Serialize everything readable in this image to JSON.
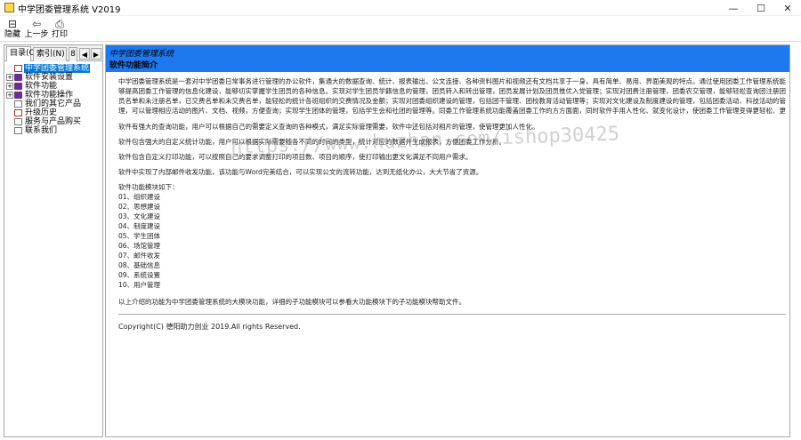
{
  "window": {
    "title": "中学团委管理系统 V2019",
    "min_glyph": "—",
    "max_glyph": "☐",
    "close_glyph": "✕"
  },
  "toolbar": {
    "hide_label": "隐藏",
    "back_label": "上一步",
    "print_label": "打印"
  },
  "sidebar": {
    "tabs": [
      {
        "label": "目录(C)"
      },
      {
        "label": "索引(N)"
      },
      {
        "label": "8"
      }
    ],
    "arrow_left": "◀",
    "arrow_right": "▶",
    "tree": [
      {
        "label": "中学团委管理系统",
        "expander": "",
        "icon": "page-q",
        "selected": true
      },
      {
        "label": "软件安装设置",
        "expander": "+",
        "icon": "book",
        "selected": false
      },
      {
        "label": "软件功能",
        "expander": "+",
        "icon": "book",
        "selected": false
      },
      {
        "label": "软件功能操作",
        "expander": "+",
        "icon": "book",
        "selected": false
      },
      {
        "label": "我们的其它产品",
        "expander": "",
        "icon": "page",
        "selected": false
      },
      {
        "label": "升级历史",
        "expander": "",
        "icon": "page-q",
        "selected": false
      },
      {
        "label": "服务与产品购买",
        "expander": "",
        "icon": "page-w",
        "selected": false
      },
      {
        "label": "联系我们",
        "expander": "",
        "icon": "page",
        "selected": false
      }
    ]
  },
  "content": {
    "header_sub": "中学团委管理系统",
    "header_title": "软件功能简介",
    "paragraphs": [
      "中学团委管理系统是一套对中学团委日常事务进行管理的办公软件，集通大的数据查询、统计、报表输出、公文连接、各种资料图片和视频还有文档共享于一身，具有简单、易用、界面美观的特点。通过使用团委工作管理系统能够提高团委工作管理的信息化建设，能够切实掌握学生团员的各种信息。实现对学生团员学籍信息的管理，团员转入和转出管理，团员发展计划及团员推优入党管理；实现对团费注册管理，团委农交管理，能够轻松查询团注册团员名单和未注册名单，已交费名单和未交费名单，能轻松的统计各班组织的交费情况及金额；实现对团委组织建设的管理，包括团干管理、团校教育活动管理等；实现对文化建设及制度建设的管理，包括团委活动、科技活动的管理，可以管理相应活动的图片、文档、视频，方便查询；实现学生团体的管理，包括学生会和社团的管理等。同委工作管理系统功能覆盖团委工作的方方面面，同时软件手用人性化、就变化设计，使团委工作管理变得更轻松、更省心。",
      "软件有强大的查询功能，用户可以根据自己的需要定义查询的各种模式，满足实际管理需要，软件中还包括对相片的管理，使管理更加人性化。",
      "软件包含强大的自定义统计功能，用户可以根据实际需要随各不同的时间的类型，统计对应的数据并生成报表，方便团委工作分析。",
      "软件包含自定义打印功能，可以按照自己的要求调整打印的项目数、项目的顺序，使打印输出更文化满足不同用户需求。",
      "软件中实现了内部邮件收发功能，该功能与Word完美结合，可以实现公文的流转功能，达到无纸化办公，大大节省了资源。"
    ],
    "modules_heading": "软件功能模块如下：",
    "modules": [
      "01、组织建设",
      "02、思想建设",
      "03、文化建设",
      "04、制度建设",
      "05、学生团体",
      "06、场馆管理",
      "07、邮件收发",
      "08、基础信息",
      "09、系统设置",
      "10、用户管理"
    ],
    "summary": "以上介绍的功能为中学团委管理系统的大模块功能，详细的子功能模块可以参看大功能模块下的子功能模块帮助文件。",
    "copyright": "Copyright(C) 德阳助力创业 2019.All rights Reserved.",
    "watermark": "https://www.huzhan.com/ishop30425"
  },
  "colors": {
    "header_band": "#1e78ee",
    "selection": "#0078d7"
  }
}
